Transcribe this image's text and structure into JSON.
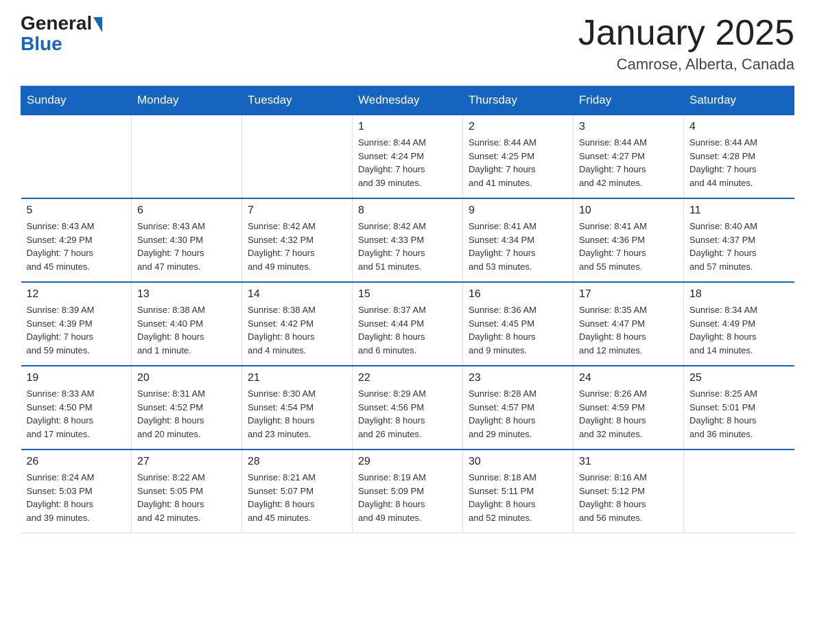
{
  "header": {
    "logo": {
      "general": "General",
      "blue": "Blue"
    },
    "title": "January 2025",
    "location": "Camrose, Alberta, Canada"
  },
  "calendar": {
    "days_of_week": [
      "Sunday",
      "Monday",
      "Tuesday",
      "Wednesday",
      "Thursday",
      "Friday",
      "Saturday"
    ],
    "weeks": [
      [
        {
          "day": "",
          "info": ""
        },
        {
          "day": "",
          "info": ""
        },
        {
          "day": "",
          "info": ""
        },
        {
          "day": "1",
          "info": "Sunrise: 8:44 AM\nSunset: 4:24 PM\nDaylight: 7 hours\nand 39 minutes."
        },
        {
          "day": "2",
          "info": "Sunrise: 8:44 AM\nSunset: 4:25 PM\nDaylight: 7 hours\nand 41 minutes."
        },
        {
          "day": "3",
          "info": "Sunrise: 8:44 AM\nSunset: 4:27 PM\nDaylight: 7 hours\nand 42 minutes."
        },
        {
          "day": "4",
          "info": "Sunrise: 8:44 AM\nSunset: 4:28 PM\nDaylight: 7 hours\nand 44 minutes."
        }
      ],
      [
        {
          "day": "5",
          "info": "Sunrise: 8:43 AM\nSunset: 4:29 PM\nDaylight: 7 hours\nand 45 minutes."
        },
        {
          "day": "6",
          "info": "Sunrise: 8:43 AM\nSunset: 4:30 PM\nDaylight: 7 hours\nand 47 minutes."
        },
        {
          "day": "7",
          "info": "Sunrise: 8:42 AM\nSunset: 4:32 PM\nDaylight: 7 hours\nand 49 minutes."
        },
        {
          "day": "8",
          "info": "Sunrise: 8:42 AM\nSunset: 4:33 PM\nDaylight: 7 hours\nand 51 minutes."
        },
        {
          "day": "9",
          "info": "Sunrise: 8:41 AM\nSunset: 4:34 PM\nDaylight: 7 hours\nand 53 minutes."
        },
        {
          "day": "10",
          "info": "Sunrise: 8:41 AM\nSunset: 4:36 PM\nDaylight: 7 hours\nand 55 minutes."
        },
        {
          "day": "11",
          "info": "Sunrise: 8:40 AM\nSunset: 4:37 PM\nDaylight: 7 hours\nand 57 minutes."
        }
      ],
      [
        {
          "day": "12",
          "info": "Sunrise: 8:39 AM\nSunset: 4:39 PM\nDaylight: 7 hours\nand 59 minutes."
        },
        {
          "day": "13",
          "info": "Sunrise: 8:38 AM\nSunset: 4:40 PM\nDaylight: 8 hours\nand 1 minute."
        },
        {
          "day": "14",
          "info": "Sunrise: 8:38 AM\nSunset: 4:42 PM\nDaylight: 8 hours\nand 4 minutes."
        },
        {
          "day": "15",
          "info": "Sunrise: 8:37 AM\nSunset: 4:44 PM\nDaylight: 8 hours\nand 6 minutes."
        },
        {
          "day": "16",
          "info": "Sunrise: 8:36 AM\nSunset: 4:45 PM\nDaylight: 8 hours\nand 9 minutes."
        },
        {
          "day": "17",
          "info": "Sunrise: 8:35 AM\nSunset: 4:47 PM\nDaylight: 8 hours\nand 12 minutes."
        },
        {
          "day": "18",
          "info": "Sunrise: 8:34 AM\nSunset: 4:49 PM\nDaylight: 8 hours\nand 14 minutes."
        }
      ],
      [
        {
          "day": "19",
          "info": "Sunrise: 8:33 AM\nSunset: 4:50 PM\nDaylight: 8 hours\nand 17 minutes."
        },
        {
          "day": "20",
          "info": "Sunrise: 8:31 AM\nSunset: 4:52 PM\nDaylight: 8 hours\nand 20 minutes."
        },
        {
          "day": "21",
          "info": "Sunrise: 8:30 AM\nSunset: 4:54 PM\nDaylight: 8 hours\nand 23 minutes."
        },
        {
          "day": "22",
          "info": "Sunrise: 8:29 AM\nSunset: 4:56 PM\nDaylight: 8 hours\nand 26 minutes."
        },
        {
          "day": "23",
          "info": "Sunrise: 8:28 AM\nSunset: 4:57 PM\nDaylight: 8 hours\nand 29 minutes."
        },
        {
          "day": "24",
          "info": "Sunrise: 8:26 AM\nSunset: 4:59 PM\nDaylight: 8 hours\nand 32 minutes."
        },
        {
          "day": "25",
          "info": "Sunrise: 8:25 AM\nSunset: 5:01 PM\nDaylight: 8 hours\nand 36 minutes."
        }
      ],
      [
        {
          "day": "26",
          "info": "Sunrise: 8:24 AM\nSunset: 5:03 PM\nDaylight: 8 hours\nand 39 minutes."
        },
        {
          "day": "27",
          "info": "Sunrise: 8:22 AM\nSunset: 5:05 PM\nDaylight: 8 hours\nand 42 minutes."
        },
        {
          "day": "28",
          "info": "Sunrise: 8:21 AM\nSunset: 5:07 PM\nDaylight: 8 hours\nand 45 minutes."
        },
        {
          "day": "29",
          "info": "Sunrise: 8:19 AM\nSunset: 5:09 PM\nDaylight: 8 hours\nand 49 minutes."
        },
        {
          "day": "30",
          "info": "Sunrise: 8:18 AM\nSunset: 5:11 PM\nDaylight: 8 hours\nand 52 minutes."
        },
        {
          "day": "31",
          "info": "Sunrise: 8:16 AM\nSunset: 5:12 PM\nDaylight: 8 hours\nand 56 minutes."
        },
        {
          "day": "",
          "info": ""
        }
      ]
    ]
  }
}
